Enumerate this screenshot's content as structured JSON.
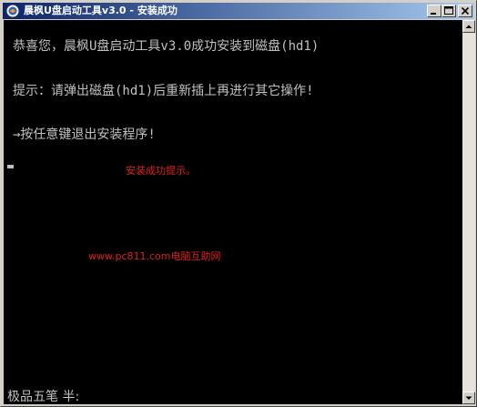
{
  "window": {
    "title": "晨枫U盘启动工具v3.0 - 安装成功"
  },
  "console": {
    "lines": [
      "恭喜您，晨枫U盘启动工具v3.0成功安装到磁盘(hd1)",
      "提示：请弹出磁盘(hd1)后重新插上再进行其它操作!",
      "→按任意键退出安装程序!"
    ],
    "ime_status": "极品五笔 半:"
  },
  "annotations": {
    "success_note": "安装成功提示。",
    "site_watermark": "www.pc811.com电脑互助网"
  },
  "colors": {
    "titlebar_start": "#0a246a",
    "titlebar_end": "#a6caf0",
    "console_bg": "#000000",
    "console_text": "#c0c0c0",
    "annotation_red": "#e02020"
  }
}
